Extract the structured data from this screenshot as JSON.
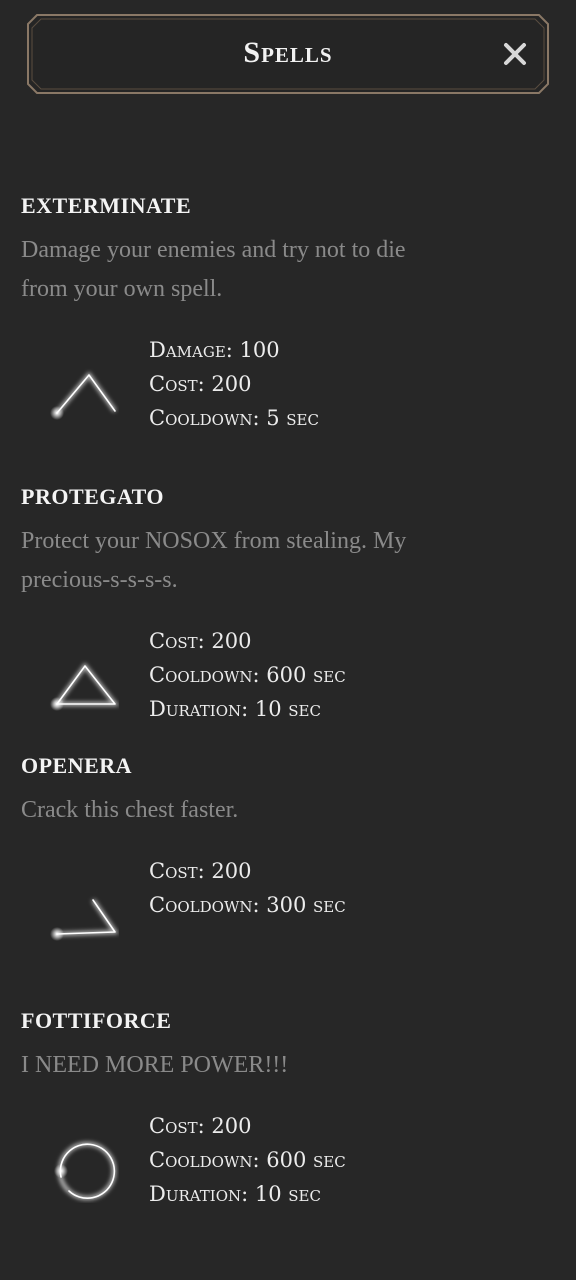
{
  "header": {
    "title": "Spells",
    "close_symbol": "✕"
  },
  "colors": {
    "background": "#272727",
    "frame_border": "#8a7866",
    "name": "#f4f4f4",
    "description": "#8a8a8a",
    "stat": "#ececec"
  },
  "spells": [
    {
      "name": "EXTERMINATE",
      "description": "Damage your enemies and try not to die from your own spell.",
      "icon": "caret-glyph-icon",
      "stats": [
        "Damage: 100",
        "Cost: 200",
        "Cooldown: 5 sec"
      ]
    },
    {
      "name": "PROTEGATO",
      "description": "Protect your NOSOX from stealing. My precious-s-s-s-s.",
      "icon": "triangle-glyph-icon",
      "stats": [
        "Cost: 200",
        "Cooldown: 600 sec",
        "Duration: 10 sec"
      ]
    },
    {
      "name": "OPENERA",
      "description": "Crack this chest faster.",
      "icon": "angle-glyph-icon",
      "stats": [
        "Cost: 200",
        "Cooldown: 300 sec"
      ]
    },
    {
      "name": "FOTTIFORCE",
      "description": "I NEED MORE POWER!!!",
      "icon": "circle-glyph-icon",
      "stats": [
        "Cost: 200",
        "Cooldown: 600 sec",
        "Duration: 10 sec"
      ]
    }
  ]
}
